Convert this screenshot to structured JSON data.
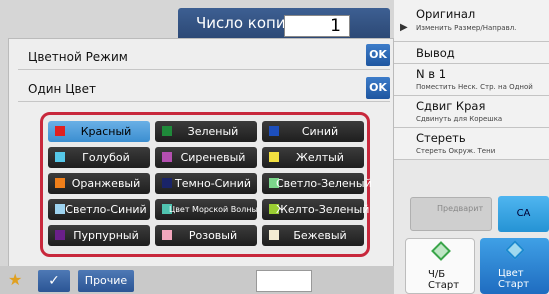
{
  "header": {
    "copies_label": "Число копий",
    "copies_value": "1"
  },
  "right_menu": [
    {
      "title": "Оригинал",
      "subtitle": "Изменить Размер/Направл."
    },
    {
      "title": "Вывод",
      "subtitle": ""
    },
    {
      "title": "N в 1",
      "subtitle": "Поместить Неск. Стр. на Одной"
    },
    {
      "title": "Сдвиг Края",
      "subtitle": "Сдвинуть для Корешка"
    },
    {
      "title": "Стереть",
      "subtitle": "Стереть Окруж. Тени"
    }
  ],
  "dialog": {
    "row1": {
      "label": "Цветной Режим",
      "ok": "OK"
    },
    "row2": {
      "label": "Один Цвет",
      "ok": "OK"
    }
  },
  "colors": [
    {
      "label": "Красный",
      "swatch": "#e02020",
      "selected": true
    },
    {
      "label": "Зеленый",
      "swatch": "#1f8a3a",
      "selected": false
    },
    {
      "label": "Синий",
      "swatch": "#1d4fbd",
      "selected": false
    },
    {
      "label": "Голубой",
      "swatch": "#55c7e8",
      "selected": false
    },
    {
      "label": "Сиреневый",
      "swatch": "#b44fb0",
      "selected": false
    },
    {
      "label": "Желтый",
      "swatch": "#f2e040",
      "selected": false
    },
    {
      "label": "Оранжевый",
      "swatch": "#f07f1a",
      "selected": false
    },
    {
      "label": "Темно-Синий",
      "swatch": "#1a2468",
      "selected": false
    },
    {
      "label": "Светло-Зеленый",
      "swatch": "#7bd68a",
      "selected": false
    },
    {
      "label": "Светло-Синий",
      "swatch": "#9ed3ef",
      "selected": false
    },
    {
      "label": "Цвет Морской Волны",
      "swatch": "#50c4b0",
      "selected": false
    },
    {
      "label": "Желто-Зеленый",
      "swatch": "#9acd32",
      "selected": false
    },
    {
      "label": "Пурпурный",
      "swatch": "#6a1f8a",
      "selected": false
    },
    {
      "label": "Розовый",
      "swatch": "#f3a6bd",
      "selected": false
    },
    {
      "label": "Бежевый",
      "swatch": "#f3ecd3",
      "selected": false
    }
  ],
  "bottom": {
    "other_label": "Прочие",
    "preview_label": "Предварит",
    "ca_label": "CA",
    "start_bw": [
      "Ч/Б",
      "Старт"
    ],
    "start_color": [
      "Цвет",
      "Старт"
    ]
  }
}
